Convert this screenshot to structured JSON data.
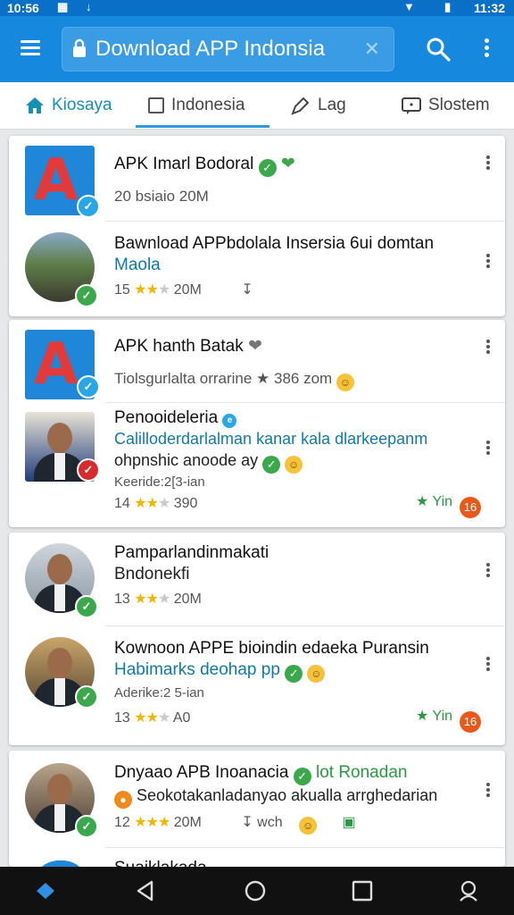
{
  "status_bar": {
    "time_left": "10:56",
    "time_right": "11:32"
  },
  "search": {
    "value": "Download APP Indonsia",
    "clear_icon": "close-icon"
  },
  "tabs": [
    {
      "label": "Kiosaya",
      "icon": "home-icon",
      "active": true
    },
    {
      "label": "Indonesia",
      "icon": "square-icon",
      "active": false
    },
    {
      "label": "Lag",
      "icon": "tag-icon",
      "active": false
    },
    {
      "label": "Slostem",
      "icon": "message-icon",
      "active": false
    }
  ],
  "colors": {
    "primary": "#1688dd",
    "accent": "#2d9bd9",
    "star": "#f4b400",
    "verified": "#3aa84b"
  },
  "cards": [
    {
      "items": [
        {
          "title": "APK Imarl Bodoral",
          "line2": "",
          "meta": "20 bsiaio 20M",
          "thumb": "app-logo",
          "badge": "blue"
        },
        {
          "title": "Bawnload APPbdolala Insersia 6ui domtan",
          "line2": "Maola",
          "meta_count": "15",
          "meta_size": "20M",
          "rating_stars": 2.5,
          "thumb": "landscape-photo",
          "badge": "green"
        }
      ]
    },
    {
      "items": [
        {
          "title": "APK hanth Batak",
          "line2": "Tiolsgurlalta orrarine ★ 386 zom",
          "thumb": "app-logo",
          "badge": "blue"
        },
        {
          "title": "Penooideleria",
          "line2": "Calilloderdarlalman kanar kala dlarkeepanm",
          "line3": "ohpnshic anoode ay",
          "line4": "Keeride:2[3-ian",
          "meta_count": "14",
          "meta_size": "390",
          "rating_stars": 2.5,
          "tag": "Yin",
          "badge_dot": "16",
          "thumb": "person-photo",
          "badge": "red"
        }
      ]
    },
    {
      "items": [
        {
          "title": "Pamparlandinmakati",
          "line2": "Bndonekfi",
          "meta_count": "13",
          "meta_size": "20M",
          "rating_stars": 2.5,
          "thumb": "person-photo",
          "badge": "green"
        },
        {
          "title": "Kownoon APPE bioindin edaeka Puransin",
          "line2": "Habimarks deohap pp",
          "line3": "Aderike:2 5-ian",
          "meta_count": "13",
          "meta_size": "A0",
          "rating_stars": 2.5,
          "tag": "Yin",
          "badge_dot": "16",
          "thumb": "person-photo",
          "badge": "green"
        }
      ]
    },
    {
      "items": [
        {
          "title": "Dnyaao APB Inoanacia",
          "title_tag": "lot Ronadan",
          "line2": "Seokotakanladanyao akualla arrghedarian",
          "meta_count": "12",
          "meta_size": "20M",
          "meta_extra": "wch",
          "rating_stars": 3,
          "thumb": "person-photo",
          "badge": "green"
        },
        {
          "title": "Suaiklakada",
          "thumb": "app-logo"
        }
      ]
    }
  ]
}
